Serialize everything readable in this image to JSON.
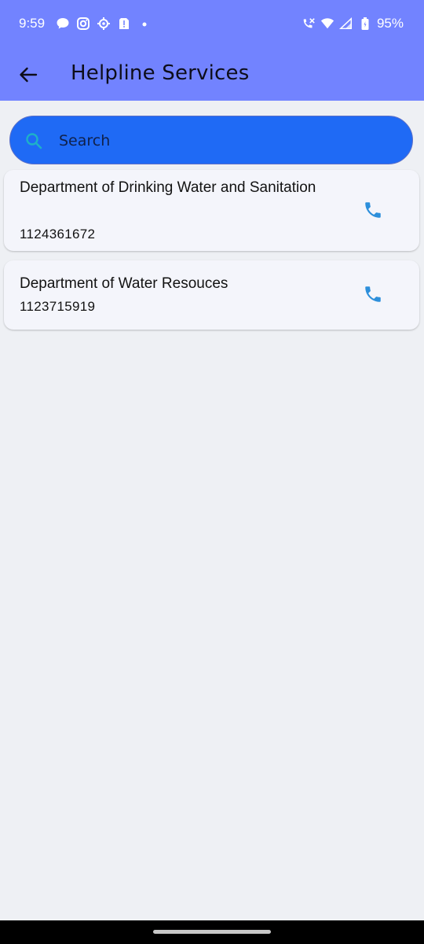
{
  "status_bar": {
    "time": "9:59",
    "battery": "95%",
    "left_icons": [
      "chat-bubble-icon",
      "instagram-icon",
      "settings-gear-icon",
      "sim-alert-icon",
      "dot-icon"
    ],
    "right_icons": [
      "wifi-call-icon",
      "wifi-icon",
      "signal-icon",
      "battery-icon"
    ]
  },
  "header": {
    "title": "Helpline Services",
    "back_icon": "arrow-back-icon"
  },
  "search": {
    "placeholder": "Search",
    "value": ""
  },
  "contacts": [
    {
      "name": "Department of Drinking Water and Sanitation",
      "phone": "1124361672"
    },
    {
      "name": "Department of Water Resouces",
      "phone": "1123715919"
    }
  ],
  "colors": {
    "app_bar": "#7283ff",
    "search_bg": "#1f6af5",
    "card_bg": "#f4f5fb",
    "call_icon": "#2d8fdb",
    "page_bg": "#eef0f4"
  }
}
